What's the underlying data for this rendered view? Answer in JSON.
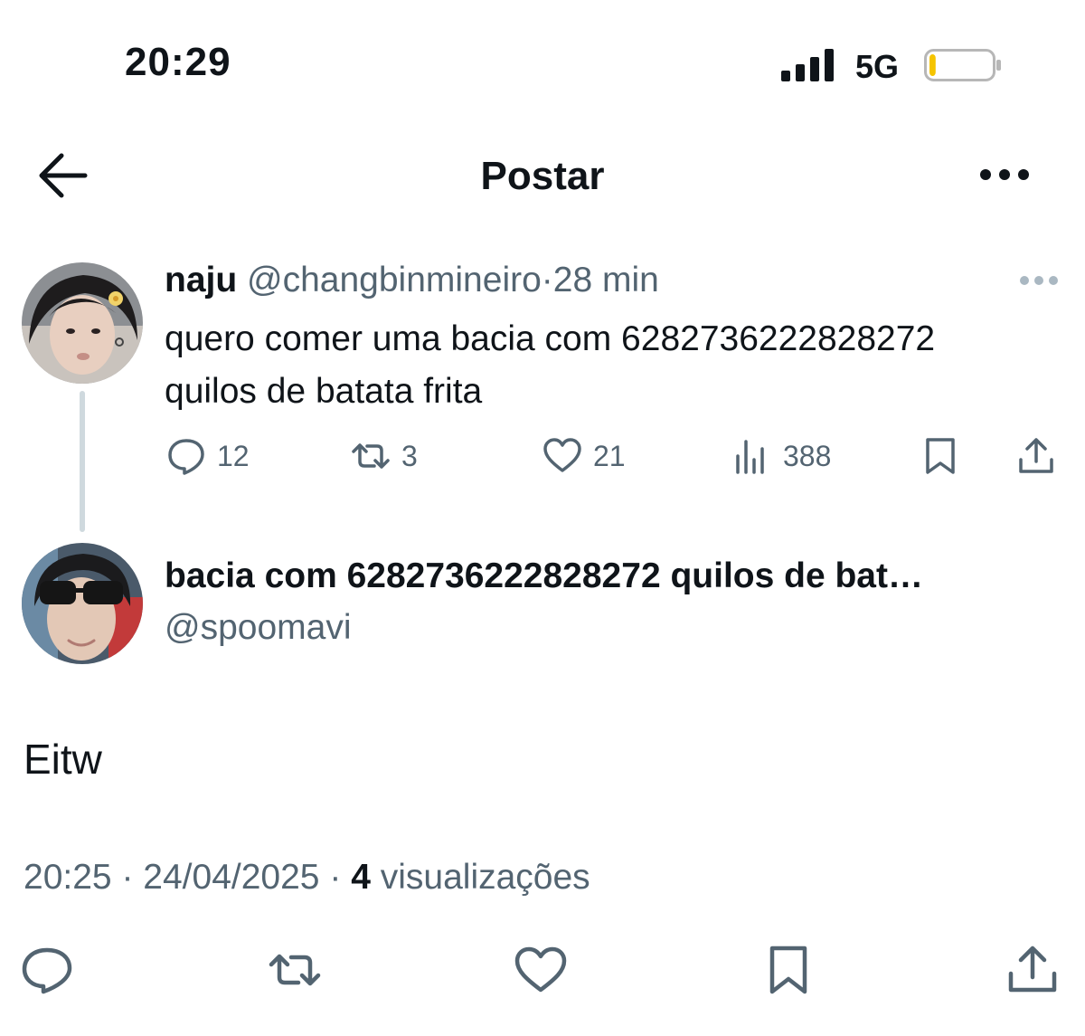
{
  "status_bar": {
    "time": "20:29",
    "network": "5G",
    "battery_level": 0.1,
    "battery_color": "#f5c400"
  },
  "header": {
    "title": "Postar",
    "back_icon": "arrow-left-icon",
    "more_icon": "more-horizontal-icon"
  },
  "parent_tweet": {
    "display_name": "naju",
    "handle": "@changbinmineiro",
    "separator": "·",
    "time_ago": "28 min",
    "text": "quero comer uma bacia com 6282736222828272\nquilos de batata frita",
    "actions": {
      "replies": "12",
      "retweets": "3",
      "likes": "21",
      "views": "388"
    }
  },
  "reply_tweet": {
    "display_name": "bacia com 6282736222828272 quilos de bat…",
    "handle": "@spoomavi",
    "text": "Eitw",
    "time": "20:25",
    "date": "24/04/2025",
    "separator": "·",
    "views_count": "4",
    "views_label": "visualizações"
  },
  "colors": {
    "text": "#0f1419",
    "secondary": "#536471",
    "thread_line": "#cfd9de"
  }
}
